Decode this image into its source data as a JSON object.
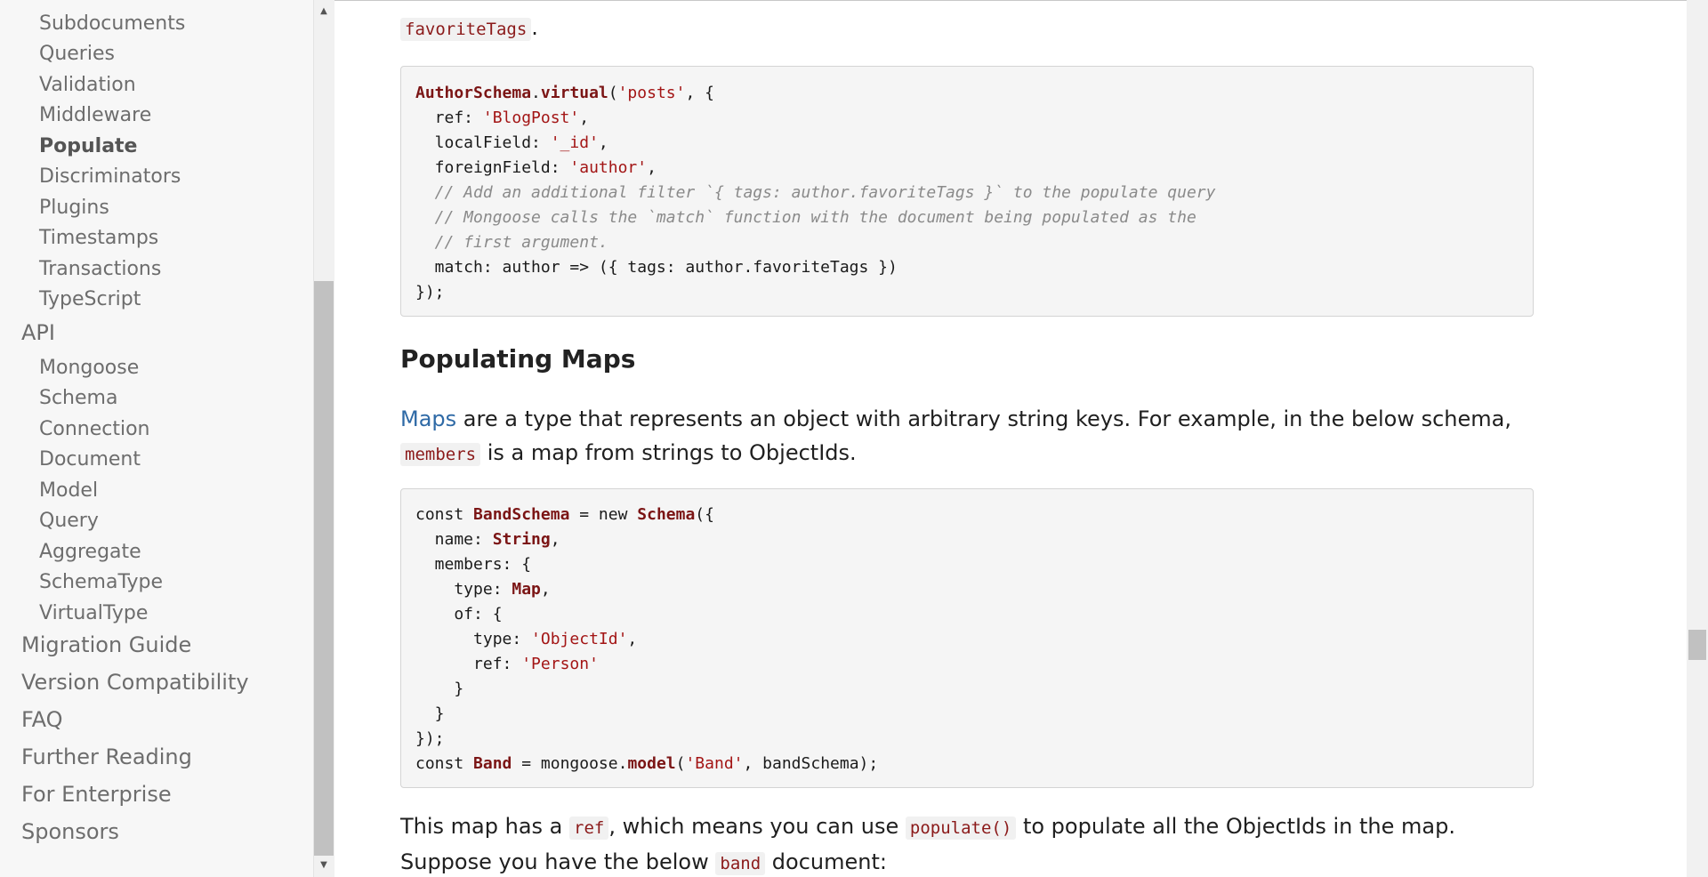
{
  "sidebar": {
    "sub_items_a": [
      {
        "label": "Subdocuments"
      },
      {
        "label": "Queries"
      },
      {
        "label": "Validation"
      },
      {
        "label": "Middleware"
      },
      {
        "label": "Populate"
      },
      {
        "label": "Discriminators"
      },
      {
        "label": "Plugins"
      },
      {
        "label": "Timestamps"
      },
      {
        "label": "Transactions"
      },
      {
        "label": "TypeScript"
      }
    ],
    "api_label": "API",
    "api_items": [
      {
        "label": "Mongoose"
      },
      {
        "label": "Schema"
      },
      {
        "label": "Connection"
      },
      {
        "label": "Document"
      },
      {
        "label": "Model"
      },
      {
        "label": "Query"
      },
      {
        "label": "Aggregate"
      },
      {
        "label": "SchemaType"
      },
      {
        "label": "VirtualType"
      }
    ],
    "top_items": [
      {
        "label": "Migration Guide"
      },
      {
        "label": "Version Compatibility"
      },
      {
        "label": "FAQ"
      },
      {
        "label": "Further Reading"
      },
      {
        "label": "For Enterprise"
      },
      {
        "label": "Sponsors"
      }
    ],
    "active_item": "Populate"
  },
  "content": {
    "intro_code": "favoriteTags",
    "intro_period": ".",
    "section_title": "Populating Maps",
    "maps_link": "Maps",
    "maps_text_1": " are a type that represents an object with arbitrary string keys. For example, in the below schema, ",
    "maps_code": "members",
    "maps_text_2": " is a map from strings to ObjectIds.",
    "bottom_text_1": "This map has a ",
    "bottom_code_1": "ref",
    "bottom_text_2": ", which means you can use ",
    "bottom_code_2": "populate()",
    "bottom_text_3": " to populate all the ObjectIds in the map. Suppose you have the below ",
    "bottom_code_3": "band",
    "bottom_text_4": " document:"
  },
  "code_block_1": [
    [
      {
        "t": "AuthorSchema",
        "c": "fn"
      },
      {
        "t": ".",
        "c": "kw"
      },
      {
        "t": "virtual",
        "c": "fn"
      },
      {
        "t": "(",
        "c": "kw"
      },
      {
        "t": "'posts'",
        "c": "str"
      },
      {
        "t": ", {",
        "c": "kw"
      }
    ],
    [
      {
        "t": "  ref: ",
        "c": "kw"
      },
      {
        "t": "'BlogPost'",
        "c": "str"
      },
      {
        "t": ",",
        "c": "kw"
      }
    ],
    [
      {
        "t": "  localField: ",
        "c": "kw"
      },
      {
        "t": "'_id'",
        "c": "str"
      },
      {
        "t": ",",
        "c": "kw"
      }
    ],
    [
      {
        "t": "  foreignField: ",
        "c": "kw"
      },
      {
        "t": "'author'",
        "c": "str"
      },
      {
        "t": ",",
        "c": "kw"
      }
    ],
    [
      {
        "t": "  // Add an additional filter `{ tags: author.favoriteTags }` to the populate query",
        "c": "cmt"
      }
    ],
    [
      {
        "t": "  // Mongoose calls the `match` function with the document being populated as the",
        "c": "cmt"
      }
    ],
    [
      {
        "t": "  // first argument.",
        "c": "cmt"
      }
    ],
    [
      {
        "t": "  match: author => ({ tags: author.favoriteTags })",
        "c": "kw"
      }
    ],
    [
      {
        "t": "});",
        "c": "kw"
      }
    ]
  ],
  "code_block_2": [
    [
      {
        "t": "const ",
        "c": "kw"
      },
      {
        "t": "BandSchema",
        "c": "cls"
      },
      {
        "t": " = new ",
        "c": "kw"
      },
      {
        "t": "Schema",
        "c": "cls"
      },
      {
        "t": "({",
        "c": "kw"
      }
    ],
    [
      {
        "t": "  name: ",
        "c": "kw"
      },
      {
        "t": "String",
        "c": "cls"
      },
      {
        "t": ",",
        "c": "kw"
      }
    ],
    [
      {
        "t": "  members: {",
        "c": "kw"
      }
    ],
    [
      {
        "t": "    type: ",
        "c": "kw"
      },
      {
        "t": "Map",
        "c": "cls"
      },
      {
        "t": ",",
        "c": "kw"
      }
    ],
    [
      {
        "t": "    of: {",
        "c": "kw"
      }
    ],
    [
      {
        "t": "      type: ",
        "c": "kw"
      },
      {
        "t": "'ObjectId'",
        "c": "str"
      },
      {
        "t": ",",
        "c": "kw"
      }
    ],
    [
      {
        "t": "      ref: ",
        "c": "kw"
      },
      {
        "t": "'Person'",
        "c": "str"
      }
    ],
    [
      {
        "t": "    }",
        "c": "kw"
      }
    ],
    [
      {
        "t": "  }",
        "c": "kw"
      }
    ],
    [
      {
        "t": "});",
        "c": "kw"
      }
    ],
    [
      {
        "t": "const ",
        "c": "kw"
      },
      {
        "t": "Band",
        "c": "cls"
      },
      {
        "t": " = mongoose.",
        "c": "kw"
      },
      {
        "t": "model",
        "c": "fn"
      },
      {
        "t": "(",
        "c": "kw"
      },
      {
        "t": "'Band'",
        "c": "str"
      },
      {
        "t": ", bandSchema);",
        "c": "kw"
      }
    ]
  ]
}
